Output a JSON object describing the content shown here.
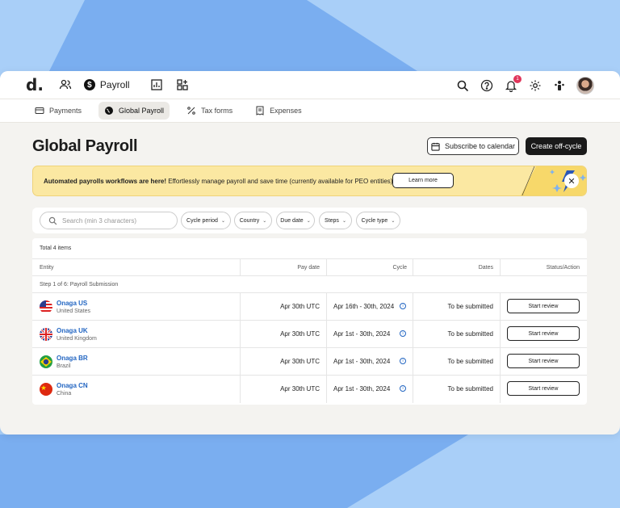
{
  "nav": {
    "logo": "d.",
    "payroll_label": "Payroll",
    "notification_count": "1"
  },
  "subnav": {
    "items": [
      {
        "label": "Payments"
      },
      {
        "label": "Global Payroll"
      },
      {
        "label": "Tax forms"
      },
      {
        "label": "Expenses"
      }
    ]
  },
  "page": {
    "title": "Global Payroll",
    "subscribe_label": "Subscribe to calendar",
    "create_label": "Create off-cycle"
  },
  "banner": {
    "bold_text": "Automated payrolls workflows are here!",
    "text": " Effortlessly manage payroll and save time (currently available for PEO entities)",
    "learn_label": "Learn more"
  },
  "filters": {
    "search_placeholder": "Search (min 3 characters)",
    "chips": [
      "Cycle period",
      "Country",
      "Due date",
      "Steps",
      "Cycle type"
    ]
  },
  "table": {
    "total": "Total 4 items",
    "headers": {
      "entity": "Entity",
      "pay_date": "Pay date",
      "cycle": "Cycle",
      "dates": "Dates",
      "status": "Status/Action"
    },
    "step_label": "Step 1 of 6: Payroll Submission",
    "rows": [
      {
        "name": "Onaga US",
        "country": "United States",
        "pay_date": "Apr 30th UTC",
        "cycle": "Apr 16th - 30th, 2024",
        "dates": "To be submitted",
        "action": "Start review"
      },
      {
        "name": "Onaga UK",
        "country": "United Kingdom",
        "pay_date": "Apr 30th UTC",
        "cycle": "Apr 1st - 30th, 2024",
        "dates": "To be submitted",
        "action": "Start review"
      },
      {
        "name": "Onaga BR",
        "country": "Brazil",
        "pay_date": "Apr 30th UTC",
        "cycle": "Apr 1st - 30th, 2024",
        "dates": "To be submitted",
        "action": "Start review"
      },
      {
        "name": "Onaga CN",
        "country": "China",
        "pay_date": "Apr 30th UTC",
        "cycle": "Apr 1st - 30th, 2024",
        "dates": "To be submitted",
        "action": "Start review"
      }
    ]
  },
  "colors": {
    "accent_blue": "#2366c2",
    "banner_yellow": "#fbe8a2",
    "background": "#a9cff8"
  }
}
